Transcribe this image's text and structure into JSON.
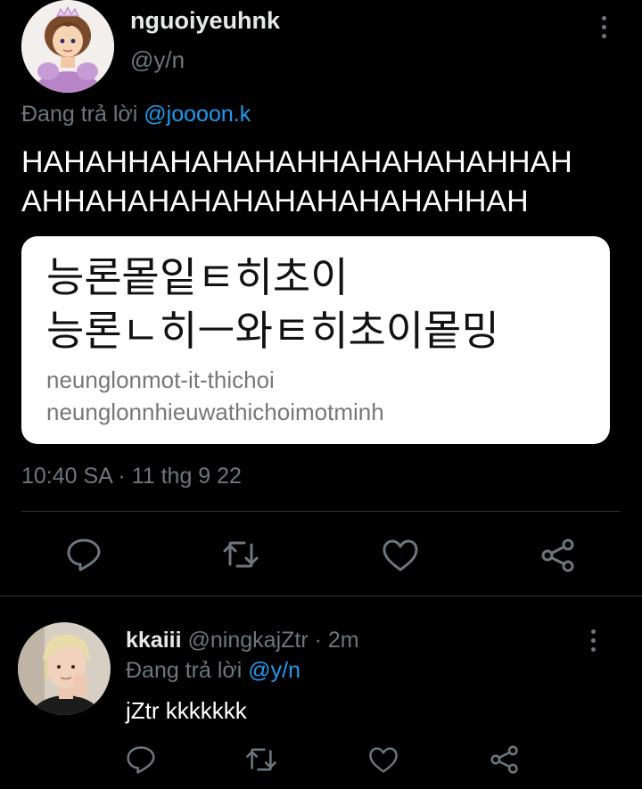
{
  "main_tweet": {
    "display_name": "nguoiyeuhnk",
    "handle": "@y/n",
    "reply_prefix": "Đang trả lời",
    "reply_target": "@joooon.k",
    "text_line1": "HAHAHHAHAHAHAHHAHAHAHAHHAH",
    "text_line2": "AHHAHAHAHAHAHAHAHAHAHHAH",
    "image": {
      "line1": "능론뫁잍ㅌ히초이",
      "line2": "능론ㄴ히ㅡ와ㅌ히초이뫁밍",
      "romanized1": "neunglonmot-it-thichoi",
      "romanized2": "neunglonnhieuwathichoimotminh"
    },
    "timestamp": "10:40 SA · 11 thg 9 22"
  },
  "reply_tweet": {
    "display_name": "kkaiii",
    "handle_time": "@ningkajZtr · 2m",
    "reply_prefix": "Đang trả lời",
    "reply_target": "@y/n",
    "text": "jZtr kkkkkkk"
  },
  "colors": {
    "background": "#000000",
    "text": "#e7e9ea",
    "muted": "#6e767d",
    "link": "#1d9bf0",
    "divider": "#2f3336"
  },
  "icons": [
    "reply-icon",
    "retweet-icon",
    "like-icon",
    "share-icon",
    "more-options-icon"
  ]
}
